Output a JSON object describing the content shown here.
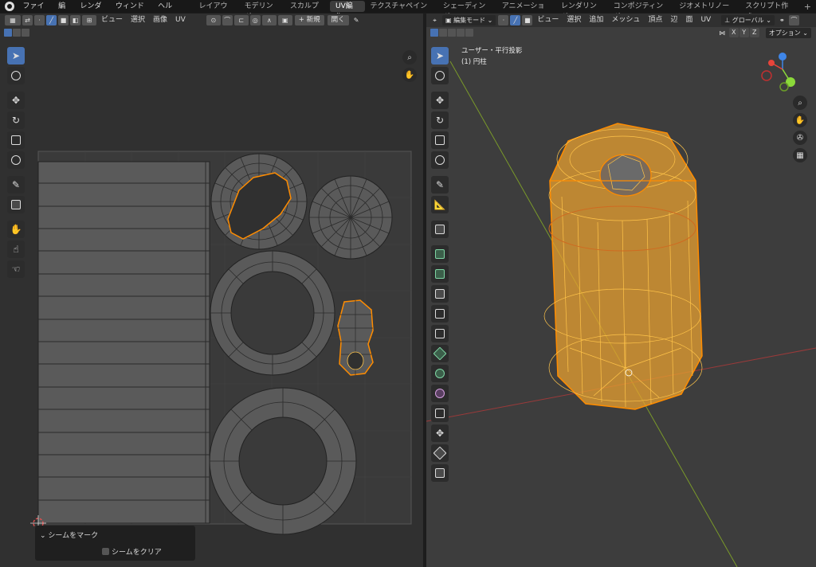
{
  "topbar": {
    "menus": [
      "ファイル",
      "編集",
      "レンダー",
      "ウィンドウ",
      "ヘルプ"
    ],
    "workspaces": [
      "レイアウト",
      "モデリング",
      "スカルプト",
      "UV編集",
      "テクスチャペイント",
      "シェーディング",
      "アニメーション",
      "レンダリング",
      "コンポジティング",
      "ジオメトリノード",
      "スクリプト作成"
    ],
    "active_workspace": "UV編集",
    "add_tab": "+"
  },
  "uv_editor": {
    "menus": [
      "ビュー",
      "選択",
      "画像",
      "UV"
    ],
    "new_button": "+ 新規",
    "open_button": "開く",
    "operator_panel": {
      "title": "シームをマーク",
      "checkbox_label": "シームをクリア"
    }
  },
  "viewport": {
    "mode": "編集モード",
    "menus": [
      "ビュー",
      "選択",
      "追加",
      "メッシュ",
      "頂点",
      "辺",
      "面",
      "UV"
    ],
    "transform_orientation": "グローバル",
    "options_button": "オプション",
    "mirror_axes": [
      "X",
      "Y",
      "Z"
    ],
    "view_name": "ユーザー・平行投影",
    "object_name": "(1) 円柱"
  },
  "colors": {
    "selection_orange": "#ff8c00",
    "wire_yellow": "#ffc44a",
    "accent_blue": "#4772b3",
    "axis_x": "#e8443a",
    "axis_y": "#8bd93a",
    "axis_z": "#3f86e8"
  }
}
